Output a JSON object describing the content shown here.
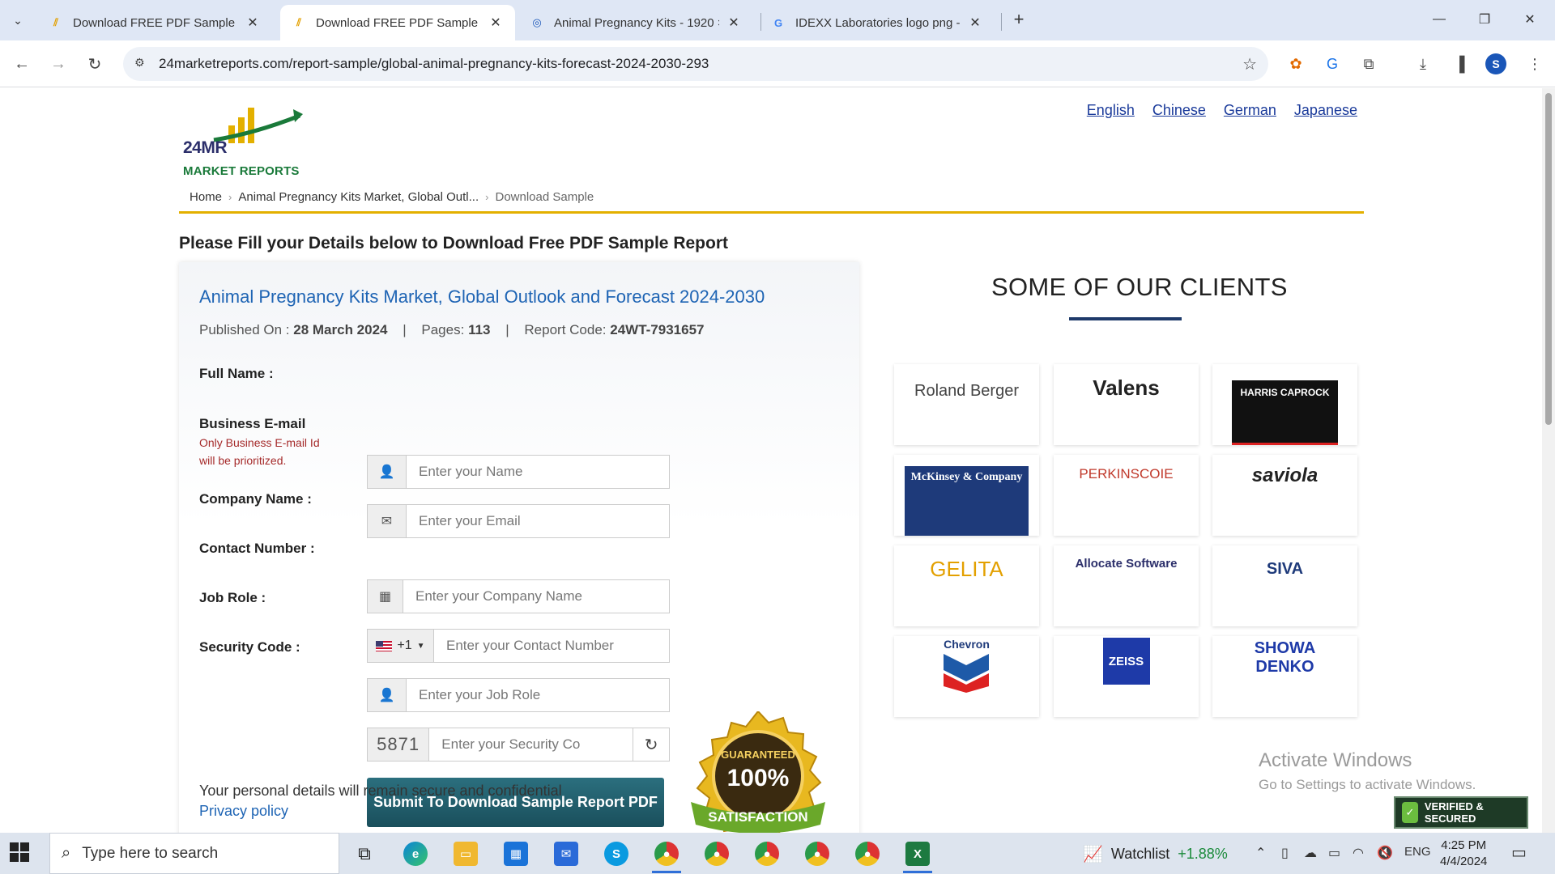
{
  "browser": {
    "tabs": [
      {
        "title": "Download FREE PDF Sample : El",
        "active": false
      },
      {
        "title": "Download FREE PDF Sample : A",
        "active": true
      },
      {
        "title": "Animal Pregnancy Kits - 1920 ×",
        "active": false
      },
      {
        "title": "IDEXX Laboratories logo png - (",
        "active": false
      }
    ],
    "url": "24marketreports.com/report-sample/global-animal-pregnancy-kits-forecast-2024-2030-293",
    "profile_initial": "S"
  },
  "site": {
    "logo_line1": "24MR",
    "logo_line2": "MARKET REPORTS",
    "languages": [
      "English",
      "Chinese",
      "German",
      "Japanese"
    ],
    "breadcrumb": [
      "Home",
      "Animal Pregnancy Kits Market, Global Outl...",
      "Download Sample"
    ],
    "heading": "Please Fill your Details below to Download Free PDF Sample Report"
  },
  "report": {
    "title": "Animal Pregnancy Kits Market, Global Outlook and Forecast 2024-2030",
    "published_label": "Published On :",
    "published_value": "28 March 2024",
    "pages_label": "Pages:",
    "pages_value": "113",
    "code_label": "Report Code:",
    "code_value": "24WT-7931657"
  },
  "form": {
    "full_name_label": "Full Name :",
    "full_name_placeholder": "Enter your Name",
    "email_label": "Business E-mail",
    "email_note": "Only Business E-mail Id will be prioritized.",
    "email_placeholder": "Enter your Email",
    "company_label": "Company Name :",
    "company_placeholder": "Enter your Company Name",
    "contact_label": "Contact Number :",
    "country_code": "+1",
    "contact_placeholder": "Enter your Contact Number",
    "job_label": "Job Role :",
    "job_placeholder": "Enter your Job Role",
    "security_label": "Security Code :",
    "security_code": "5871",
    "security_placeholder": "Enter your Security Co",
    "submit_label": "Submit To Download Sample Report PDF",
    "badge_top": "GUARANTEED",
    "badge_mid": "100%",
    "badge_bottom": "SATISFACTION",
    "secure_text": "Your personal details will remain secure and confidential",
    "privacy_link": "Privacy policy"
  },
  "clients": {
    "title": "SOME OF OUR CLIENTS",
    "logos": [
      "Roland Berger",
      "Valens",
      "HARRIS CAPROCK",
      "McKinsey & Company",
      "PERKINSCOIE",
      "saviola",
      "GELITA",
      "Allocate Software",
      "SIVA",
      "Chevron",
      "ZEISS",
      "SHOWA DENKO"
    ]
  },
  "overlay": {
    "activate_title": "Activate Windows",
    "activate_sub": "Go to Settings to activate Windows.",
    "godaddy": "VERIFIED & SECURED"
  },
  "taskbar": {
    "search_placeholder": "Type here to search",
    "watchlist_label": "Watchlist",
    "watchlist_change": "+1.88%",
    "lang": "ENG",
    "time": "4:25 PM",
    "date": "4/4/2024"
  },
  "colors": {
    "accent_blue": "#1e64b4",
    "gold_rule": "#e3b000",
    "submit_teal": "#1a4f5c"
  }
}
